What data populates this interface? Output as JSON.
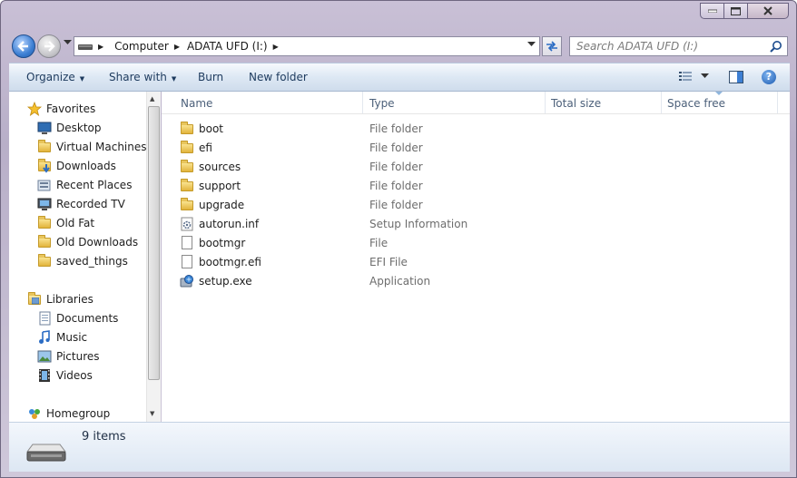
{
  "address": {
    "segments": [
      "Computer",
      "ADATA UFD (I:)"
    ]
  },
  "search": {
    "placeholder": "Search ADATA UFD (I:)"
  },
  "toolbar": {
    "organize": "Organize",
    "share_with": "Share with",
    "burn": "Burn",
    "new_folder": "New folder"
  },
  "nav": {
    "favorites_header": "Favorites",
    "favorites": [
      "Desktop",
      "Virtual Machines",
      "Downloads",
      "Recent Places",
      "Recorded TV",
      "Old Fat",
      "Old Downloads",
      "saved_things"
    ],
    "libraries_header": "Libraries",
    "libraries": [
      "Documents",
      "Music",
      "Pictures",
      "Videos"
    ],
    "homegroup": "Homegroup"
  },
  "columns": {
    "name": "Name",
    "type": "Type",
    "total_size": "Total size",
    "space_free": "Space free"
  },
  "files": [
    {
      "name": "boot",
      "type": "File folder",
      "icon": "folder-icon"
    },
    {
      "name": "efi",
      "type": "File folder",
      "icon": "folder-icon"
    },
    {
      "name": "sources",
      "type": "File folder",
      "icon": "folder-icon"
    },
    {
      "name": "support",
      "type": "File folder",
      "icon": "folder-icon"
    },
    {
      "name": "upgrade",
      "type": "File folder",
      "icon": "folder-icon"
    },
    {
      "name": "autorun.inf",
      "type": "Setup Information",
      "icon": "setup-info-icon"
    },
    {
      "name": "bootmgr",
      "type": "File",
      "icon": "file-icon"
    },
    {
      "name": "bootmgr.efi",
      "type": "EFI File",
      "icon": "file-icon"
    },
    {
      "name": "setup.exe",
      "type": "Application",
      "icon": "setup-app-icon"
    }
  ],
  "status": {
    "item_count": "9 items"
  }
}
